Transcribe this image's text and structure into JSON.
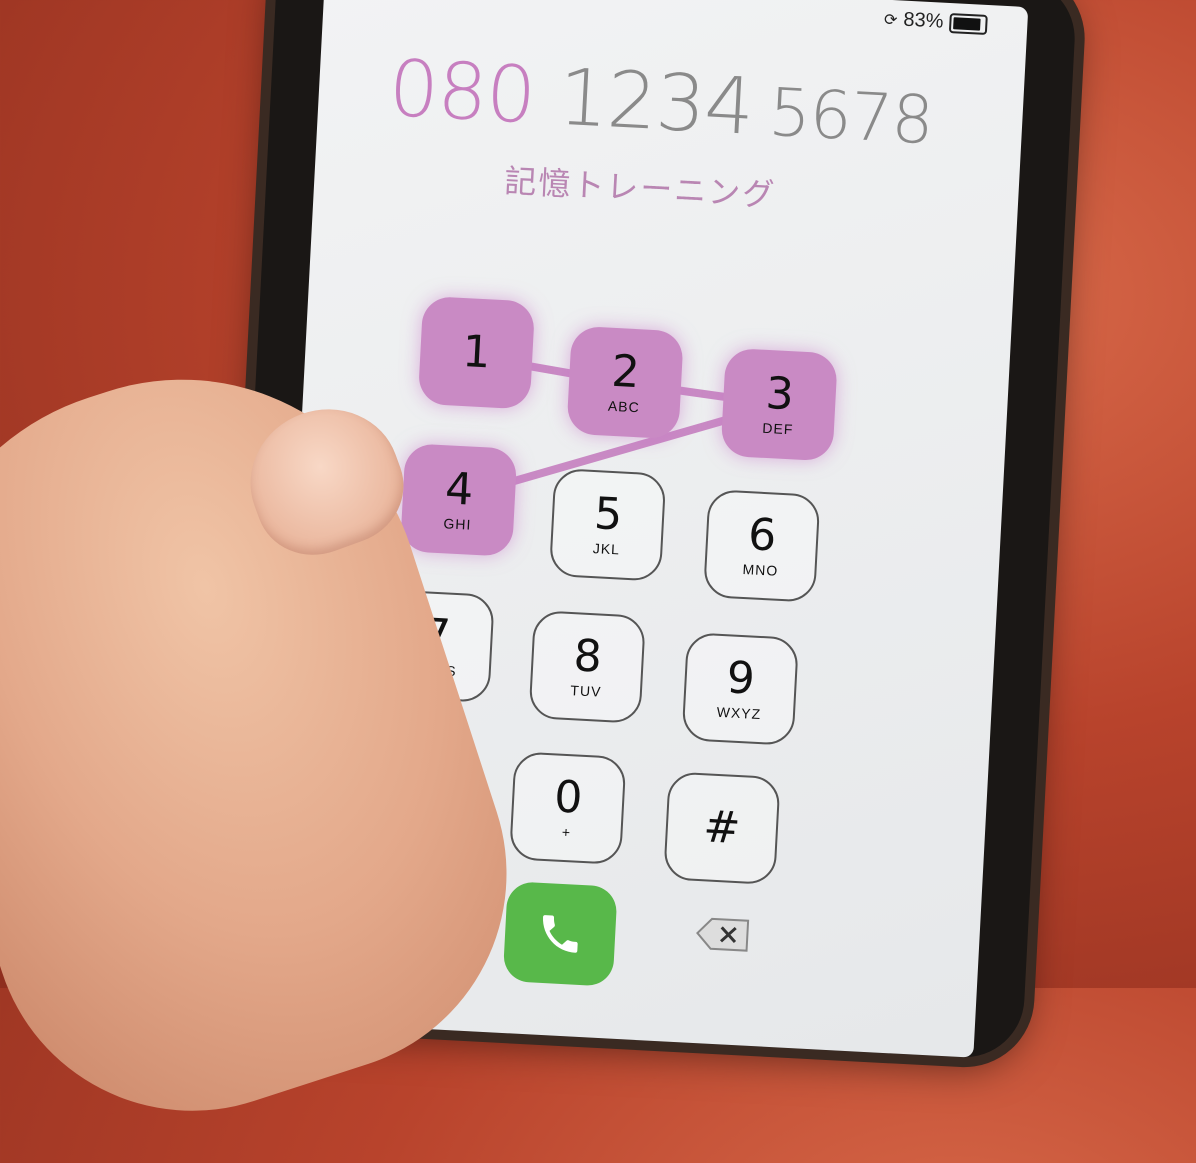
{
  "status": {
    "battery": "83%"
  },
  "display": {
    "part1": "080",
    "part2": "1234",
    "part3": "5678"
  },
  "subtitle": "記憶トレーニング",
  "keys": [
    {
      "digit": "1",
      "letters": ""
    },
    {
      "digit": "2",
      "letters": "ABC"
    },
    {
      "digit": "3",
      "letters": "DEF"
    },
    {
      "digit": "4",
      "letters": "GHI"
    },
    {
      "digit": "5",
      "letters": "JKL"
    },
    {
      "digit": "6",
      "letters": "MNO"
    },
    {
      "digit": "7",
      "letters": "PQRS"
    },
    {
      "digit": "8",
      "letters": "TUV"
    },
    {
      "digit": "9",
      "letters": "WXYZ"
    },
    {
      "digit": "*",
      "letters": ""
    },
    {
      "digit": "0",
      "letters": "+"
    },
    {
      "digit": "#",
      "letters": ""
    }
  ],
  "highlighted_keys": [
    "1",
    "2",
    "3",
    "4"
  ],
  "colors": {
    "highlight": "#c98ac4",
    "call": "#58b84a"
  },
  "icons": {
    "call": "phone-icon",
    "delete": "backspace-icon"
  }
}
